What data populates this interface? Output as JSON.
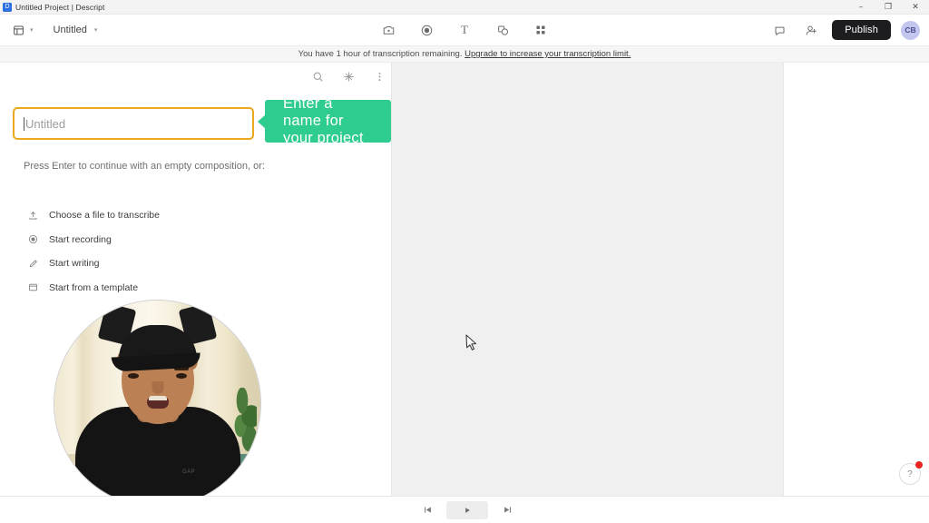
{
  "window": {
    "title": "Untitled Project | Descript",
    "app_icon": "descript-icon",
    "controls": {
      "minimize": "–",
      "maximize": "❒",
      "close": "✕"
    }
  },
  "header": {
    "menu_icon": "layout-menu-icon",
    "menu_chevron": "▾",
    "project_name": "Untitled",
    "project_chevron": "▾",
    "center_tools": [
      {
        "name": "media-capture-icon",
        "label": "Media"
      },
      {
        "name": "record-icon",
        "label": "Record"
      },
      {
        "name": "text-icon",
        "label": "T"
      },
      {
        "name": "shapes-icon",
        "label": "Shapes"
      },
      {
        "name": "apps-grid-icon",
        "label": "Apps"
      }
    ],
    "comment_icon": "comment-icon",
    "invite_icon": "add-person-icon",
    "publish_label": "Publish",
    "avatar_initials": "CB"
  },
  "banner": {
    "text": "You have 1 hour of transcription remaining.",
    "link_text": "Upgrade to increase your transcription limit."
  },
  "left_panel": {
    "tools": [
      {
        "name": "search-icon",
        "label": "Search"
      },
      {
        "name": "ai-sparkle-icon",
        "label": "AI actions"
      },
      {
        "name": "more-options-icon",
        "label": "More"
      }
    ],
    "name_input": {
      "value": "",
      "placeholder": "Untitled"
    },
    "callout_text": "Enter a name for your project",
    "hint": "Press Enter to continue with an empty composition, or:",
    "options": [
      {
        "icon": "upload-icon",
        "label": "Choose a file to transcribe"
      },
      {
        "icon": "record-circle-icon",
        "label": "Start recording"
      },
      {
        "icon": "pencil-icon",
        "label": "Start writing"
      },
      {
        "icon": "template-window-icon",
        "label": "Start from a template"
      }
    ],
    "webcam_logo": "GAP"
  },
  "transport": {
    "skip_back": "skip-to-start-icon",
    "play": "play-icon",
    "skip_forward": "skip-to-end-icon"
  },
  "help": {
    "label": "?",
    "has_notification": true
  },
  "colors": {
    "callout_green": "#2ecc8f",
    "input_border_orange": "#eca81e",
    "publish_black": "#1d1d1f",
    "avatar_bg": "#c3c6ef",
    "notification_red": "#e8251f",
    "canvas_grey": "#f0f0f0"
  }
}
